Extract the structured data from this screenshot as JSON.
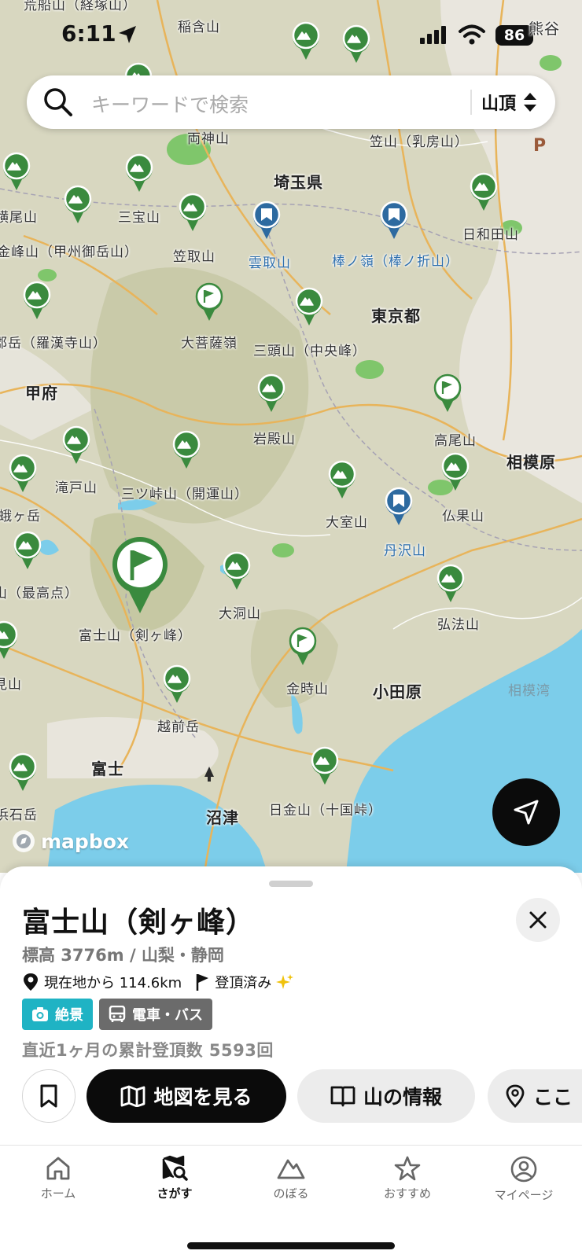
{
  "status": {
    "time": "6:11",
    "battery": "86",
    "corner_city": "熊谷"
  },
  "search": {
    "placeholder": "キーワードで検索",
    "filter_label": "山頂"
  },
  "map": {
    "attribution": "mapbox",
    "labels": {
      "top_misc1": "荒船山（経塚山）",
      "inari": "稲含山",
      "ryokami": "両神山",
      "kasa": "笠山（乳房山）",
      "saitama": "埼玉県",
      "yokooyama": "横尾山",
      "sanpo": "三宝山",
      "kinpu": "金峰山（甲州御岳山）",
      "kasatori": "笠取山",
      "kumotori": "雲取山",
      "bounore": "棒ノ嶺（棒ノ折山）",
      "hiwada": "日和田山",
      "tokyo": "東京都",
      "rakan": "郡岳（羅漢寺山）",
      "daibosatsu": "大菩薩嶺",
      "santo": "三頭山（中央峰）",
      "kofu": "甲府",
      "iwadono": "岩殿山",
      "takao": "高尾山",
      "sagamihara": "相模原",
      "takido": "滝戸山",
      "mitsutoge": "三ツ峠山（開運山）",
      "omuro": "大室山",
      "bukka": "仏果山",
      "tanzawa": "丹沢山",
      "kagatake": "蛾ヶ岳",
      "saikoten": "山（最高点）",
      "fuji": "富士山（剣ヶ峰）",
      "obora": "大洞山",
      "kobo": "弘法山",
      "kintoki": "金時山",
      "odawara": "小田原",
      "sagamiwan": "相模湾",
      "echizen": "越前岳",
      "fujicity": "富士",
      "numazu": "沼津",
      "higane": "日金山（十国峠）",
      "hamaishi": "浜石岳",
      "edgeyama": "見山"
    }
  },
  "sheet": {
    "title": "富士山（剣ヶ峰）",
    "elevation": "標高 3776m / 山梨・静岡",
    "distance": "現在地から 114.6km",
    "summited": "登頂済み",
    "tags": [
      {
        "label": "絶景",
        "color": "#1fb3c4"
      },
      {
        "label": "電車・バス",
        "color": "#6b6b6b"
      }
    ],
    "cumulative": "直近1ヶ月の累計登頂数 5593回",
    "buttons": {
      "map": "地図を見る",
      "info": "山の情報",
      "here": "ここ"
    }
  },
  "tabs": [
    {
      "label": "ホーム"
    },
    {
      "label": "さがす"
    },
    {
      "label": "のぼる"
    },
    {
      "label": "おすすめ"
    },
    {
      "label": "マイページ"
    }
  ],
  "colors": {
    "pin_green": "#3a8a3e",
    "pin_blue": "#2d6aa0",
    "sea": "#7ccdea",
    "accent": "#111111"
  }
}
